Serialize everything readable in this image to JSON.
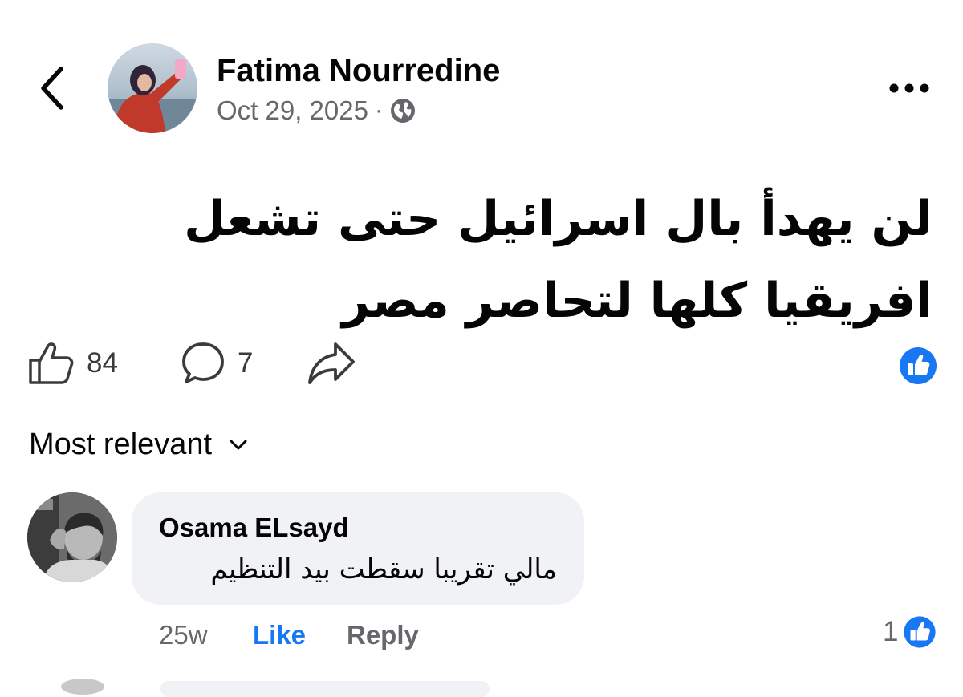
{
  "post": {
    "author_name": "Fatima Nourredine",
    "date": "Oct 29, 2025",
    "separator": "·",
    "privacy_icon": "globe-icon",
    "text_line1": "لن يهدأ بال اسرائيل حتى تشعل",
    "text_line2": "افريقيا كلها لتحاصر مصر",
    "like_count": "84",
    "comment_count": "7"
  },
  "colors": {
    "accent": "#1877f2",
    "secondary_text": "#65676b",
    "bubble": "#f0f2f5"
  },
  "sort": {
    "label": "Most relevant"
  },
  "comments": [
    {
      "author": "Osama ELsayd",
      "text": "مالي تقريبا سقطت بيد التنظيم",
      "time": "25w",
      "like_label": "Like",
      "reply_label": "Reply",
      "reaction_count": "1"
    }
  ]
}
